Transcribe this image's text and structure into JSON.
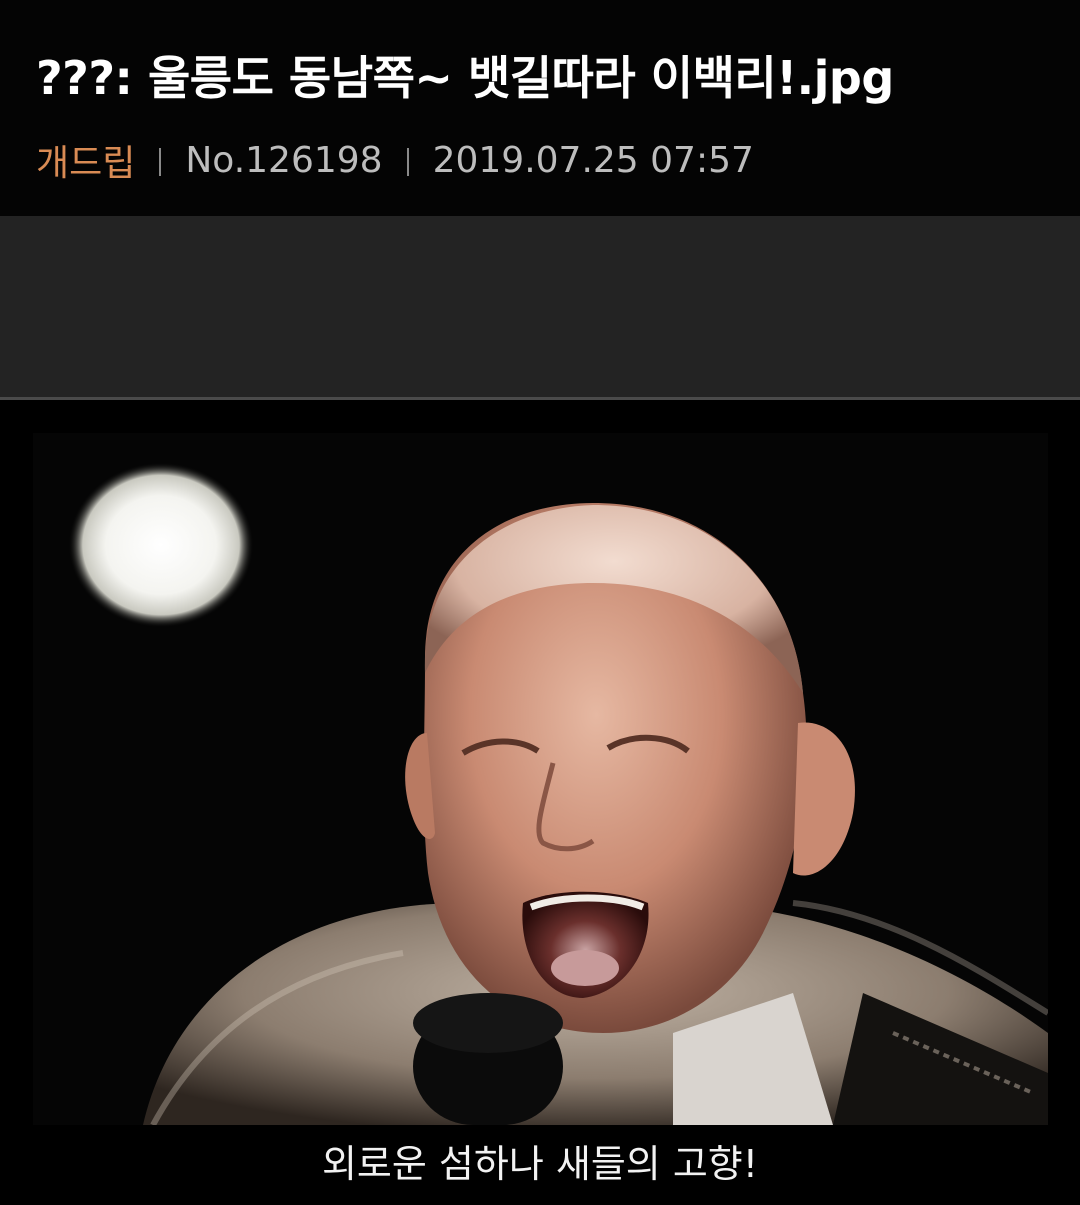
{
  "post": {
    "title": "???: 울릉도 동남쪽~ 뱃길따라 이백리!.jpg",
    "board": "개드립",
    "number": "No.126198",
    "datetime": "2019.07.25 07:57"
  },
  "image": {
    "caption": "외로운 섬하나 새들의 고향!"
  },
  "colors": {
    "background": "#000000",
    "header": "#040404",
    "board_accent": "#d98b54",
    "ad_area": "#232323"
  }
}
